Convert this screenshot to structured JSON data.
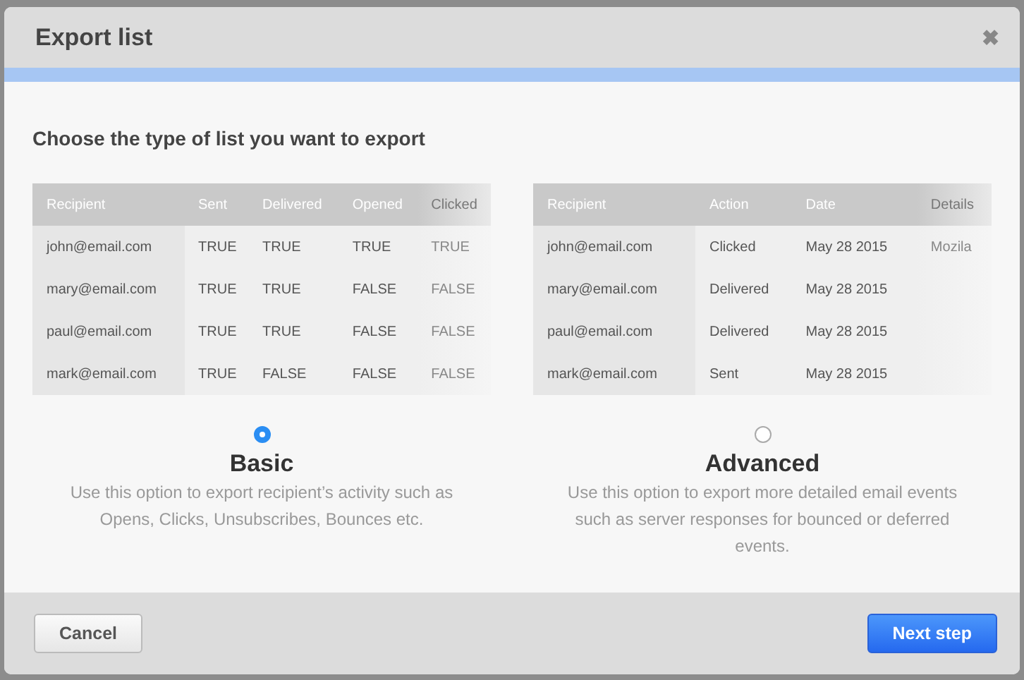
{
  "dialog": {
    "title": "Export list",
    "close": "✖"
  },
  "prompt": "Choose the type of list you want to export",
  "options": [
    {
      "selected": true,
      "title": "Basic",
      "description": "Use this option to export recipient’s activity such as Opens, Clicks, Unsubscribes, Bounces etc.",
      "table": {
        "columns": [
          "Recipient",
          "Sent",
          "Delivered",
          "Opened",
          "Clicked"
        ],
        "rows": [
          [
            "john@email.com",
            "TRUE",
            "TRUE",
            "TRUE",
            "TRUE"
          ],
          [
            "mary@email.com",
            "TRUE",
            "TRUE",
            "FALSE",
            "FALSE"
          ],
          [
            "paul@email.com",
            "TRUE",
            "TRUE",
            "FALSE",
            "FALSE"
          ],
          [
            "mark@email.com",
            "TRUE",
            "FALSE",
            "FALSE",
            "FALSE"
          ]
        ]
      }
    },
    {
      "selected": false,
      "title": "Advanced",
      "description": "Use this option to export more detailed email events such as server responses for bounced or deferred events.",
      "table": {
        "columns": [
          "Recipient",
          "Action",
          "Date",
          "Details"
        ],
        "rows": [
          [
            "john@email.com",
            "Clicked",
            "May 28 2015",
            "Mozila"
          ],
          [
            "mary@email.com",
            "Delivered",
            "May 28 2015",
            ""
          ],
          [
            "paul@email.com",
            "Delivered",
            "May 28 2015",
            ""
          ],
          [
            "mark@email.com",
            "Sent",
            "May 28 2015",
            ""
          ]
        ]
      }
    }
  ],
  "buttons": {
    "cancel": "Cancel",
    "next": "Next step"
  }
}
